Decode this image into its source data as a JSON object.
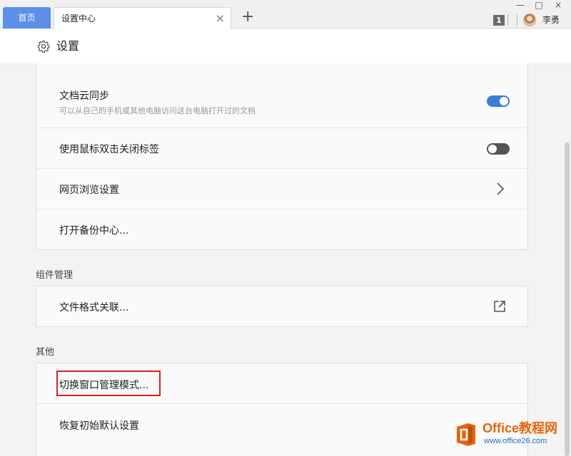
{
  "tabs": {
    "home_label": "首页",
    "settings_label": "设置中心",
    "close_glyph": "×",
    "new_tab_glyph": "+"
  },
  "window": {
    "min_glyph": "—",
    "max_glyph": "□",
    "close_glyph": "×",
    "tab_count": "1",
    "username": "李勇"
  },
  "header": {
    "icon": "gear-icon",
    "title": "设置"
  },
  "general": {
    "rows": [
      {
        "label": "文档云同步",
        "sub": "可以从自己的手机或其他电脑访问这台电脑打开过的文档",
        "control": "toggle",
        "value": true
      },
      {
        "label": "使用鼠标双击关闭标签",
        "control": "toggle",
        "value": false
      },
      {
        "label": "网页浏览设置",
        "control": "chevron-right-icon"
      },
      {
        "label": "打开备份中心..."
      }
    ]
  },
  "components": {
    "title": "组件管理",
    "rows": [
      {
        "label": "文件格式关联...",
        "control": "external-link-icon"
      }
    ]
  },
  "others": {
    "title": "其他",
    "rows": [
      {
        "label": "切换窗口管理模式...",
        "highlighted": true
      },
      {
        "label": "恢复初始默认设置"
      }
    ]
  },
  "watermark": {
    "title": "Office教程网",
    "url": "www.office26.com"
  },
  "colors": {
    "accent": "#3c7fd6",
    "tab_home": "#5b8fe8",
    "highlight": "#e02020",
    "watermark_orange": "#e8640c"
  }
}
